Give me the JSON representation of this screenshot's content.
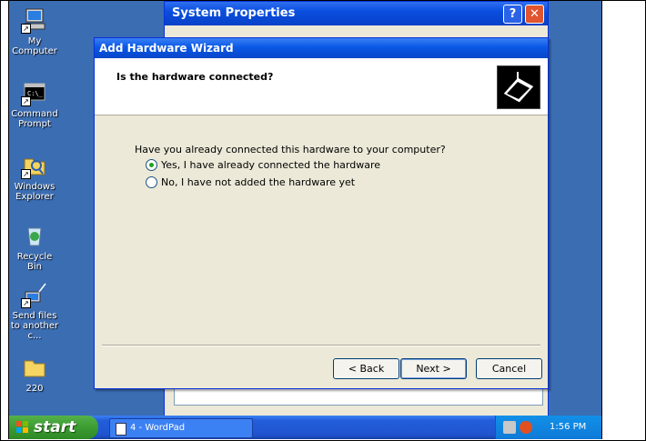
{
  "desktop": {
    "icons": [
      {
        "label": "My Computer"
      },
      {
        "label": "Command Prompt"
      },
      {
        "label": "Windows Explorer"
      },
      {
        "label": "Recycle Bin"
      },
      {
        "label": "Send files to another c..."
      },
      {
        "label": "220"
      }
    ]
  },
  "system_properties": {
    "title": "System Properties",
    "help_button": "?",
    "close_button": "✕"
  },
  "wizard": {
    "title": "Add Hardware Wizard",
    "header": "Is the hardware connected?",
    "question": "Have you already connected this hardware to your computer?",
    "options": [
      {
        "label": "Yes, I have already connected the hardware",
        "selected": true
      },
      {
        "label": "No, I have not added the hardware yet",
        "selected": false
      }
    ],
    "buttons": {
      "back": "< Back",
      "next": "Next >",
      "cancel": "Cancel"
    }
  },
  "taskbar": {
    "start_label": "start",
    "task_label": "4 - WordPad",
    "clock": "1:56 PM"
  },
  "colors": {
    "desktop_bg": "#3b6db3",
    "title_blue": "#0a58e6",
    "start_green": "#3c9b31"
  }
}
